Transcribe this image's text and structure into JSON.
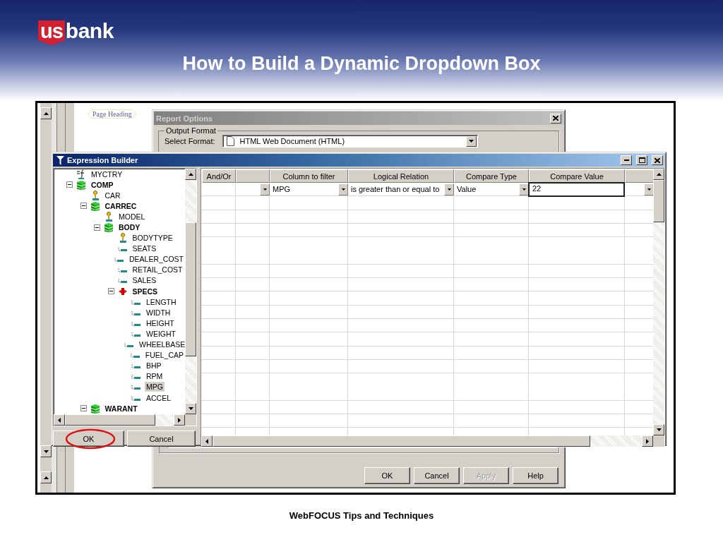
{
  "logo": {
    "mark": "us",
    "word": "bank"
  },
  "title": "How to Build a Dynamic Dropdown Box",
  "screenshot": {
    "page_heading": "Page Heading",
    "report_options": {
      "title": "Report Options",
      "group": "Output Format",
      "format_label": "Select Format:",
      "format_value": "HTML Web Document (HTML)",
      "buttons": [
        {
          "label": "OK",
          "disabled": false
        },
        {
          "label": "Cancel",
          "disabled": false
        },
        {
          "label": "Apply",
          "disabled": true
        },
        {
          "label": "Help",
          "disabled": false
        }
      ]
    },
    "expression_builder": {
      "title": "Expression Builder",
      "tree": [
        {
          "label": "MYCTRY",
          "kind": "formula",
          "selected": false
        },
        {
          "label": "COMP",
          "kind": "segment",
          "expanded": true,
          "selected": false,
          "children": [
            {
              "label": "CAR",
              "kind": "key",
              "selected": false
            },
            {
              "label": "CARREC",
              "kind": "segment",
              "expanded": true,
              "selected": false,
              "children": [
                {
                  "label": "MODEL",
                  "kind": "key",
                  "selected": false
                },
                {
                  "label": "BODY",
                  "kind": "segment",
                  "expanded": true,
                  "selected": false,
                  "children": [
                    {
                      "label": "BODYTYPE",
                      "kind": "key",
                      "selected": false
                    },
                    {
                      "label": "SEATS",
                      "kind": "field",
                      "selected": false
                    },
                    {
                      "label": "DEALER_COST",
                      "kind": "field",
                      "selected": false
                    },
                    {
                      "label": "RETAIL_COST",
                      "kind": "field",
                      "selected": false
                    },
                    {
                      "label": "SALES",
                      "kind": "field",
                      "selected": false
                    },
                    {
                      "label": "SPECS",
                      "kind": "group",
                      "expanded": true,
                      "selected": false,
                      "children": [
                        {
                          "label": "LENGTH",
                          "kind": "field",
                          "selected": false
                        },
                        {
                          "label": "WIDTH",
                          "kind": "field",
                          "selected": false
                        },
                        {
                          "label": "HEIGHT",
                          "kind": "field",
                          "selected": false
                        },
                        {
                          "label": "WEIGHT",
                          "kind": "field",
                          "selected": false
                        },
                        {
                          "label": "WHEELBASE",
                          "kind": "field",
                          "selected": false
                        },
                        {
                          "label": "FUEL_CAP",
                          "kind": "field",
                          "selected": false
                        },
                        {
                          "label": "BHP",
                          "kind": "field",
                          "selected": false
                        },
                        {
                          "label": "RPM",
                          "kind": "field",
                          "selected": false
                        },
                        {
                          "label": "MPG",
                          "kind": "field",
                          "selected": true
                        },
                        {
                          "label": "ACCEL",
                          "kind": "field",
                          "selected": false
                        }
                      ]
                    }
                  ]
                }
              ]
            },
            {
              "label": "WARANT",
              "kind": "segment",
              "expanded": true,
              "selected": false
            }
          ]
        }
      ],
      "buttons": [
        {
          "label": "OK",
          "circled": true
        },
        {
          "label": "Cancel",
          "circled": false
        }
      ],
      "grid": {
        "columns": [
          {
            "label": "And/Or"
          },
          {},
          {
            "label": "Column to filter"
          },
          {
            "label": "Logical Relation"
          },
          {
            "label": "Compare Type"
          },
          {
            "label": "Compare Value"
          },
          {}
        ],
        "rows": [
          {
            "cells": [
              {},
              {
                "dropdown": true
              },
              {
                "value": "MPG",
                "dropdown": true
              },
              {
                "value": "is greater than or equal to",
                "dropdown": true
              },
              {
                "value": "Value",
                "dropdown": true
              },
              {
                "value": "22",
                "kind": "edit"
              },
              {
                "dropdown": true
              }
            ]
          }
        ]
      }
    }
  },
  "footer": "WebFOCUS Tips and Techniques"
}
